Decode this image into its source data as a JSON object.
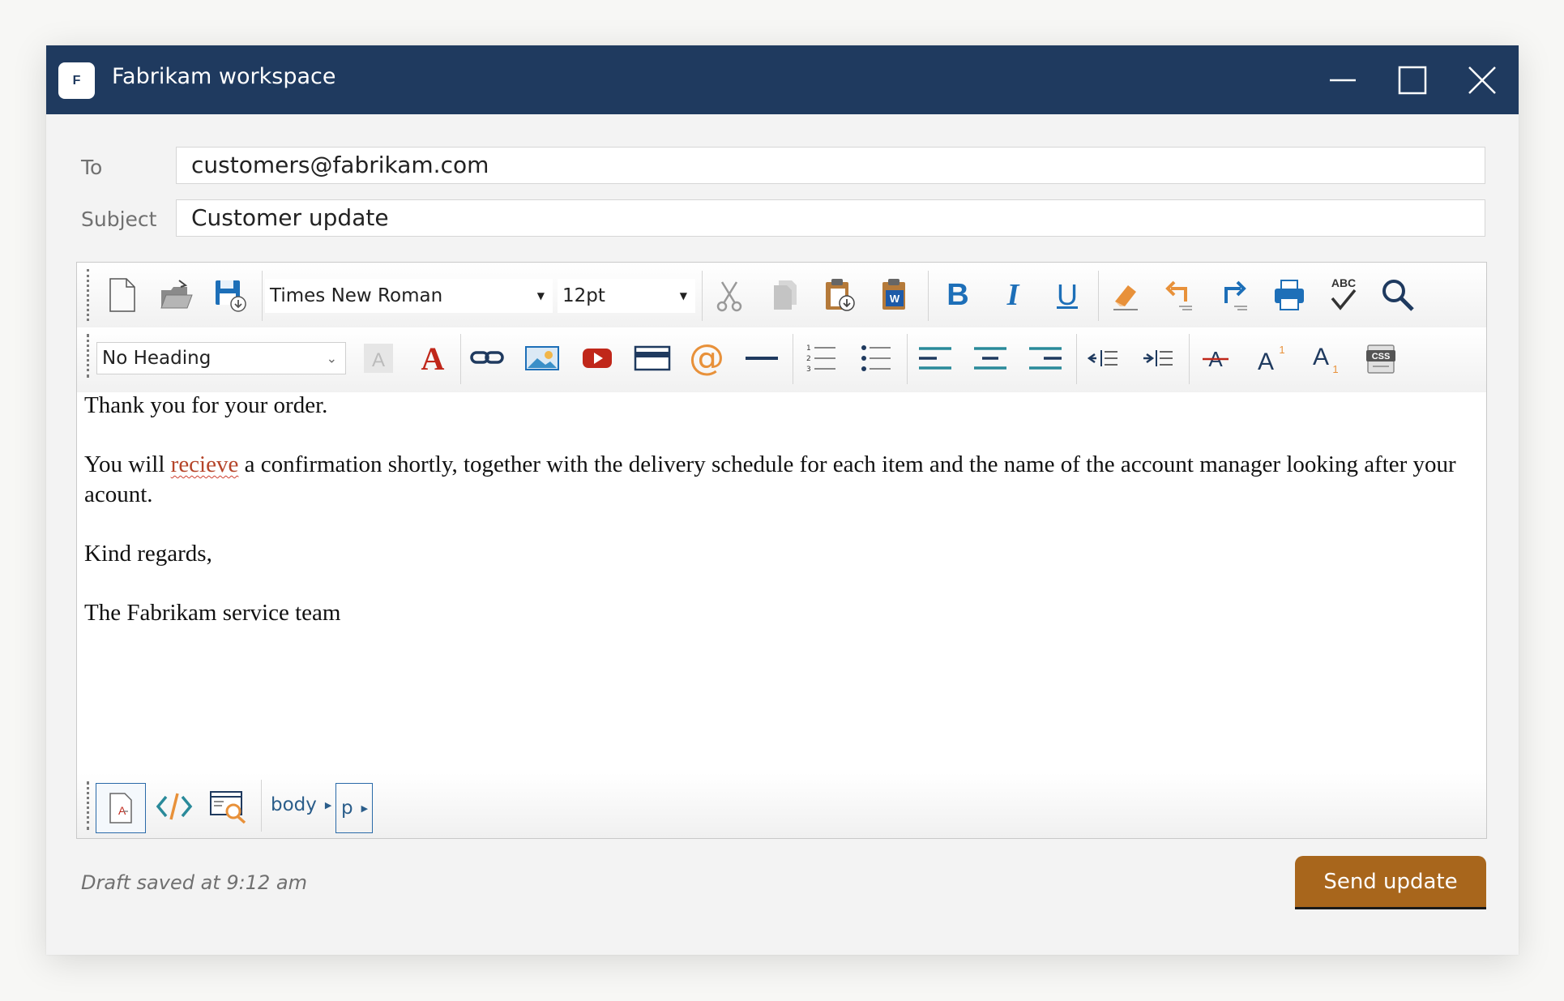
{
  "window": {
    "title": "Fabrikam workspace",
    "logo_letter": "F"
  },
  "compose": {
    "to_label": "To",
    "to_value": "customers@fabrikam.com",
    "subject_label": "Subject",
    "subject_value": "Customer update"
  },
  "toolbar": {
    "font_family": "Times New Roman",
    "font_size": "12pt",
    "heading": "No Heading",
    "spellcheck_label": "ABC",
    "css_label": "CSS",
    "superscript_label": "A",
    "superscript_digit": "1",
    "subscript_label": "A",
    "subscript_digit": "1",
    "bold_label": "B",
    "italic_label": "I",
    "underline_label": "U"
  },
  "body": {
    "p1": "Thank you for your order.",
    "p2_before": "You will ",
    "p2_misspelled": "recieve",
    "p2_after": " a confirmation shortly, together with the delivery schedule for each item and the name of the account manager looking after your acount.",
    "p3": "Kind regards,",
    "p4": "The Fabrikam service team"
  },
  "breadcrumb": {
    "items": [
      "body",
      "p"
    ]
  },
  "footer": {
    "status": "Draft saved at 9:12 am",
    "send_label": "Send update"
  },
  "colors": {
    "titlebar": "#1f3a5f",
    "accent_button": "#a8661c",
    "icon_blue": "#1d6fb8",
    "icon_red": "#c0271a",
    "icon_orange": "#e8913a",
    "icon_teal": "#2a8a9a"
  }
}
